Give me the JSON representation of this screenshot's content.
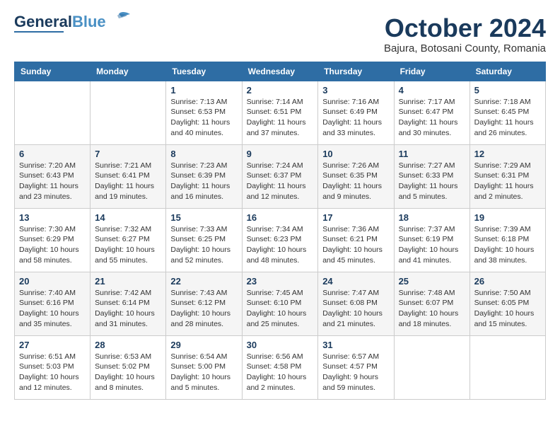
{
  "logo": {
    "line1": "General",
    "line2": "Blue"
  },
  "title": "October 2024",
  "subtitle": "Bajura, Botosani County, Romania",
  "days_header": [
    "Sunday",
    "Monday",
    "Tuesday",
    "Wednesday",
    "Thursday",
    "Friday",
    "Saturday"
  ],
  "weeks": [
    [
      {
        "day": "",
        "text": ""
      },
      {
        "day": "",
        "text": ""
      },
      {
        "day": "1",
        "text": "Sunrise: 7:13 AM\nSunset: 6:53 PM\nDaylight: 11 hours and 40 minutes."
      },
      {
        "day": "2",
        "text": "Sunrise: 7:14 AM\nSunset: 6:51 PM\nDaylight: 11 hours and 37 minutes."
      },
      {
        "day": "3",
        "text": "Sunrise: 7:16 AM\nSunset: 6:49 PM\nDaylight: 11 hours and 33 minutes."
      },
      {
        "day": "4",
        "text": "Sunrise: 7:17 AM\nSunset: 6:47 PM\nDaylight: 11 hours and 30 minutes."
      },
      {
        "day": "5",
        "text": "Sunrise: 7:18 AM\nSunset: 6:45 PM\nDaylight: 11 hours and 26 minutes."
      }
    ],
    [
      {
        "day": "6",
        "text": "Sunrise: 7:20 AM\nSunset: 6:43 PM\nDaylight: 11 hours and 23 minutes."
      },
      {
        "day": "7",
        "text": "Sunrise: 7:21 AM\nSunset: 6:41 PM\nDaylight: 11 hours and 19 minutes."
      },
      {
        "day": "8",
        "text": "Sunrise: 7:23 AM\nSunset: 6:39 PM\nDaylight: 11 hours and 16 minutes."
      },
      {
        "day": "9",
        "text": "Sunrise: 7:24 AM\nSunset: 6:37 PM\nDaylight: 11 hours and 12 minutes."
      },
      {
        "day": "10",
        "text": "Sunrise: 7:26 AM\nSunset: 6:35 PM\nDaylight: 11 hours and 9 minutes."
      },
      {
        "day": "11",
        "text": "Sunrise: 7:27 AM\nSunset: 6:33 PM\nDaylight: 11 hours and 5 minutes."
      },
      {
        "day": "12",
        "text": "Sunrise: 7:29 AM\nSunset: 6:31 PM\nDaylight: 11 hours and 2 minutes."
      }
    ],
    [
      {
        "day": "13",
        "text": "Sunrise: 7:30 AM\nSunset: 6:29 PM\nDaylight: 10 hours and 58 minutes."
      },
      {
        "day": "14",
        "text": "Sunrise: 7:32 AM\nSunset: 6:27 PM\nDaylight: 10 hours and 55 minutes."
      },
      {
        "day": "15",
        "text": "Sunrise: 7:33 AM\nSunset: 6:25 PM\nDaylight: 10 hours and 52 minutes."
      },
      {
        "day": "16",
        "text": "Sunrise: 7:34 AM\nSunset: 6:23 PM\nDaylight: 10 hours and 48 minutes."
      },
      {
        "day": "17",
        "text": "Sunrise: 7:36 AM\nSunset: 6:21 PM\nDaylight: 10 hours and 45 minutes."
      },
      {
        "day": "18",
        "text": "Sunrise: 7:37 AM\nSunset: 6:19 PM\nDaylight: 10 hours and 41 minutes."
      },
      {
        "day": "19",
        "text": "Sunrise: 7:39 AM\nSunset: 6:18 PM\nDaylight: 10 hours and 38 minutes."
      }
    ],
    [
      {
        "day": "20",
        "text": "Sunrise: 7:40 AM\nSunset: 6:16 PM\nDaylight: 10 hours and 35 minutes."
      },
      {
        "day": "21",
        "text": "Sunrise: 7:42 AM\nSunset: 6:14 PM\nDaylight: 10 hours and 31 minutes."
      },
      {
        "day": "22",
        "text": "Sunrise: 7:43 AM\nSunset: 6:12 PM\nDaylight: 10 hours and 28 minutes."
      },
      {
        "day": "23",
        "text": "Sunrise: 7:45 AM\nSunset: 6:10 PM\nDaylight: 10 hours and 25 minutes."
      },
      {
        "day": "24",
        "text": "Sunrise: 7:47 AM\nSunset: 6:08 PM\nDaylight: 10 hours and 21 minutes."
      },
      {
        "day": "25",
        "text": "Sunrise: 7:48 AM\nSunset: 6:07 PM\nDaylight: 10 hours and 18 minutes."
      },
      {
        "day": "26",
        "text": "Sunrise: 7:50 AM\nSunset: 6:05 PM\nDaylight: 10 hours and 15 minutes."
      }
    ],
    [
      {
        "day": "27",
        "text": "Sunrise: 6:51 AM\nSunset: 5:03 PM\nDaylight: 10 hours and 12 minutes."
      },
      {
        "day": "28",
        "text": "Sunrise: 6:53 AM\nSunset: 5:02 PM\nDaylight: 10 hours and 8 minutes."
      },
      {
        "day": "29",
        "text": "Sunrise: 6:54 AM\nSunset: 5:00 PM\nDaylight: 10 hours and 5 minutes."
      },
      {
        "day": "30",
        "text": "Sunrise: 6:56 AM\nSunset: 4:58 PM\nDaylight: 10 hours and 2 minutes."
      },
      {
        "day": "31",
        "text": "Sunrise: 6:57 AM\nSunset: 4:57 PM\nDaylight: 9 hours and 59 minutes."
      },
      {
        "day": "",
        "text": ""
      },
      {
        "day": "",
        "text": ""
      }
    ]
  ]
}
